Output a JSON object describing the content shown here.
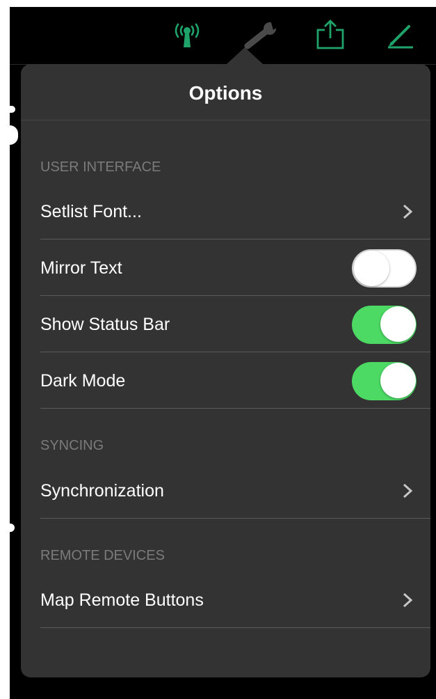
{
  "toolbar": {
    "icons": [
      "wireless-antenna-icon",
      "wrench-icon",
      "share-icon",
      "pencil-icon"
    ],
    "accent_color": "#1fa36b"
  },
  "popover": {
    "title": "Options",
    "sections": [
      {
        "header": "USER INTERFACE",
        "rows": [
          {
            "label": "Setlist Font...",
            "accessory": "chevron"
          },
          {
            "label": "Mirror Text",
            "accessory": "toggle",
            "on": false
          },
          {
            "label": "Show Status Bar",
            "accessory": "toggle",
            "on": true
          },
          {
            "label": "Dark Mode",
            "accessory": "toggle",
            "on": true
          }
        ]
      },
      {
        "header": "SYNCING",
        "rows": [
          {
            "label": "Synchronization",
            "accessory": "chevron"
          }
        ]
      },
      {
        "header": "REMOTE DEVICES",
        "rows": [
          {
            "label": "Map Remote Buttons",
            "accessory": "chevron"
          }
        ]
      }
    ]
  },
  "colors": {
    "toggle_on": "#4cd964",
    "popover_background": "#333333",
    "section_header_text": "#7b7b7b"
  }
}
